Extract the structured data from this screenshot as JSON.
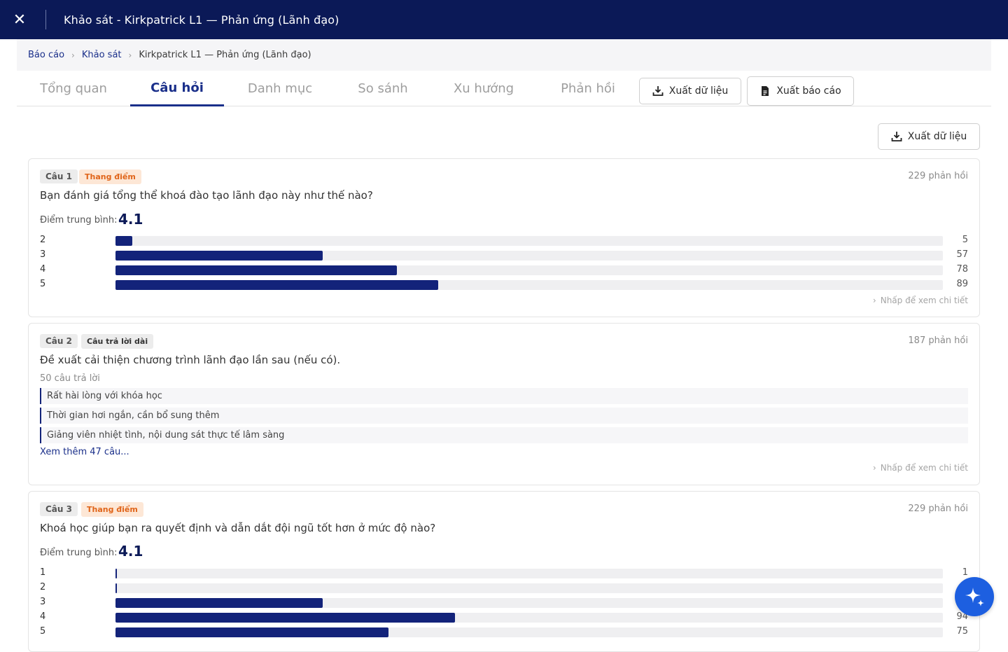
{
  "header": {
    "close_icon": "close-icon",
    "title": "Khảo sát - Kirkpatrick L1 — Phản ứng (Lãnh đạo)"
  },
  "breadcrumb": {
    "items": [
      "Báo cáo",
      "Khảo sát"
    ],
    "current": "Kirkpatrick L1 — Phản ứng (Lãnh đạo)"
  },
  "tabs": [
    {
      "label": "Tổng quan"
    },
    {
      "label": "Câu hỏi"
    },
    {
      "label": "Danh mục"
    },
    {
      "label": "So sánh"
    },
    {
      "label": "Xu hướng"
    },
    {
      "label": "Phản hồi"
    }
  ],
  "active_tab": "Câu hỏi",
  "toolbar": {
    "export_data_label": "Xuất dữ liệu",
    "export_report_label": "Xuất báo cáo"
  },
  "content_export_label": "Xuất dữ liệu",
  "questions": [
    {
      "number": "Câu 1",
      "type": "Thang điểm",
      "responses": "229 phản hồi",
      "text": "Bạn đánh giá tổng thể khoá đào tạo lãnh đạo này như thế nào?",
      "avg_label": "Điểm trung bình:",
      "avg_value": "4.1",
      "bars": [
        {
          "label": "2",
          "count": "5",
          "fraction": 0.02
        },
        {
          "label": "3",
          "count": "57",
          "fraction": 0.25
        },
        {
          "label": "4",
          "count": "78",
          "fraction": 0.34
        },
        {
          "label": "5",
          "count": "89",
          "fraction": 0.39
        }
      ],
      "detail_link": "Nhấp để xem chi tiết"
    },
    {
      "number": "Câu 2",
      "type": "Câu trả lời dài",
      "responses": "187 phản hồi",
      "text": "Đề xuất cải thiện chương trình lãnh đạo lần sau (nếu có).",
      "answers_count": "50 câu trả lời",
      "answers": [
        "Rất hài lòng với khóa học",
        "Thời gian hơi ngắn, cần bổ sung thêm",
        "Giảng viên nhiệt tình, nội dung sát thực tế lâm sàng"
      ],
      "see_more": "Xem thêm 47 câu...",
      "detail_link": "Nhấp để xem chi tiết"
    },
    {
      "number": "Câu 3",
      "type": "Thang điểm",
      "responses": "229 phản hồi",
      "text": "Khoá học giúp bạn ra quyết định và dẫn dắt đội ngũ tốt hơn ở mức độ nào?",
      "avg_label": "Điểm trung bình:",
      "avg_value": "4.1",
      "bars": [
        {
          "label": "1",
          "count": "1",
          "fraction": 0.002
        },
        {
          "label": "2",
          "count": "",
          "fraction": 0.002
        },
        {
          "label": "3",
          "count": "",
          "fraction": 0.25
        },
        {
          "label": "4",
          "count": "94",
          "fraction": 0.41
        },
        {
          "label": "5",
          "count": "75",
          "fraction": 0.33
        }
      ]
    }
  ],
  "colors": {
    "navy": "#0b1957",
    "bar": "#13237a",
    "accent_orange": "#e0651a",
    "fab": "#1d5fe0"
  },
  "fab_icon": "sparkle-icon"
}
